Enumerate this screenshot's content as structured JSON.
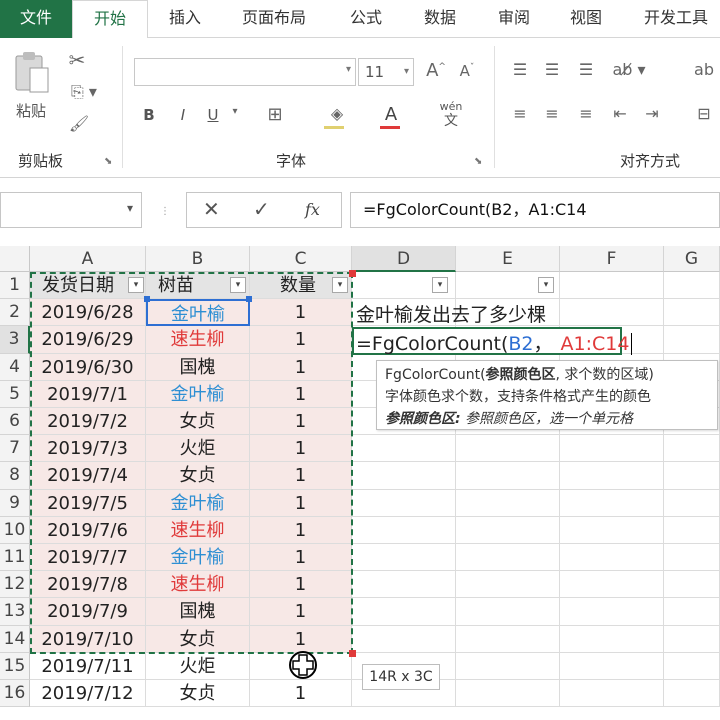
{
  "tabs": [
    {
      "label": "文件"
    },
    {
      "label": "开始"
    },
    {
      "label": "插入"
    },
    {
      "label": "页面布局"
    },
    {
      "label": "公式"
    },
    {
      "label": "数据"
    },
    {
      "label": "审阅"
    },
    {
      "label": "视图"
    },
    {
      "label": "开发工具"
    }
  ],
  "ribbon": {
    "clipboard": {
      "paste_label": "粘贴",
      "group_label": "剪贴板"
    },
    "font": {
      "size": "11",
      "bold": "B",
      "italic": "I",
      "underline": "U",
      "wen": "wén",
      "wen2": "文",
      "group_label": "字体"
    },
    "align": {
      "group_label": "对齐方式"
    }
  },
  "formula_bar": {
    "fx": "fx",
    "formula": "=FgColorCount(B2，A1:C14"
  },
  "columns": [
    "A",
    "B",
    "C",
    "D",
    "E",
    "F",
    "G"
  ],
  "rows": [
    "1",
    "2",
    "3",
    "4",
    "5",
    "6",
    "7",
    "8",
    "9",
    "10",
    "11",
    "12",
    "13",
    "14",
    "15",
    "16"
  ],
  "table": {
    "headers": [
      "发货日期",
      "树苗",
      "数量"
    ],
    "data": [
      {
        "date": "2019/6/28",
        "tree": "金叶榆",
        "qty": "1",
        "color": "blue"
      },
      {
        "date": "2019/6/29",
        "tree": "速生柳",
        "qty": "1",
        "color": "red"
      },
      {
        "date": "2019/6/30",
        "tree": "国槐",
        "qty": "1",
        "color": "black"
      },
      {
        "date": "2019/7/1",
        "tree": "金叶榆",
        "qty": "1",
        "color": "blue"
      },
      {
        "date": "2019/7/2",
        "tree": "女贞",
        "qty": "1",
        "color": "black"
      },
      {
        "date": "2019/7/3",
        "tree": "火炬",
        "qty": "1",
        "color": "black"
      },
      {
        "date": "2019/7/4",
        "tree": "女贞",
        "qty": "1",
        "color": "black"
      },
      {
        "date": "2019/7/5",
        "tree": "金叶榆",
        "qty": "1",
        "color": "blue"
      },
      {
        "date": "2019/7/6",
        "tree": "速生柳",
        "qty": "1",
        "color": "red"
      },
      {
        "date": "2019/7/7",
        "tree": "金叶榆",
        "qty": "1",
        "color": "blue"
      },
      {
        "date": "2019/7/8",
        "tree": "速生柳",
        "qty": "1",
        "color": "red"
      },
      {
        "date": "2019/7/9",
        "tree": "国槐",
        "qty": "1",
        "color": "black"
      },
      {
        "date": "2019/7/10",
        "tree": "女贞",
        "qty": "1",
        "color": "black"
      },
      {
        "date": "2019/7/11",
        "tree": "火炬",
        "qty": "",
        "color": "black"
      },
      {
        "date": "2019/7/12",
        "tree": "女贞",
        "qty": "1",
        "color": "black"
      }
    ]
  },
  "d2_text": "金叶榆发出去了多少棵",
  "d3_formula": {
    "prefix": "=FgColorCount(",
    "ref1": "B2",
    "sep": "，",
    "ref2": "A1:C14"
  },
  "tooltip": {
    "line1_fn": "FgColorCount(",
    "line1_bold": "参照颜色区",
    "line1_rest": ", 求个数的区域)",
    "line2": "字体颜色求个数，支持条件格式产生的颜色",
    "line3_bold": "参照颜色区:",
    "line3_rest": " 参照颜色区，选一个单元格"
  },
  "size_tip": "14R x 3C",
  "colors": {
    "excel_green": "#217346",
    "blue_text": "#2e8fd3",
    "red_text": "#e03a3a",
    "range_shade": "#f7e8e6"
  }
}
